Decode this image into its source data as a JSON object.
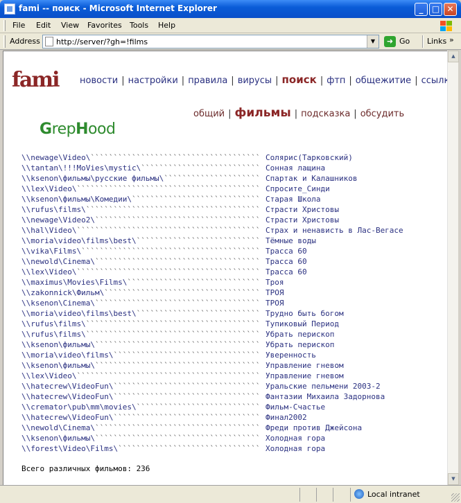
{
  "window": {
    "title": "fami -- поиск - Microsoft Internet Explorer",
    "min_glyph": "_",
    "max_glyph": "□",
    "close_glyph": "✕"
  },
  "menu": {
    "items": [
      "File",
      "Edit",
      "View",
      "Favorites",
      "Tools",
      "Help"
    ]
  },
  "address": {
    "label": "Address",
    "url": "http://server/?gh=!films",
    "go_label": "Go",
    "links_label": "Links",
    "more": "»"
  },
  "page": {
    "logo": "fami",
    "nav": [
      "новости",
      "настройки",
      "правила",
      "вирусы",
      "поиск",
      "фтп",
      "общежитие",
      "ссылки"
    ],
    "nav_active": "поиск",
    "subnav": [
      "общий",
      "фильмы",
      "подсказка",
      "обсудить"
    ],
    "subnav_active": "фильмы",
    "grephood": {
      "g": "G",
      "rep": "rep",
      "h": "H",
      "ood": "ood"
    },
    "results": [
      {
        "path": "\\\\newage\\Video\\",
        "film": "Солярис(Тарковский)"
      },
      {
        "path": "\\\\tantan\\!!!MoVies\\mystic\\",
        "film": "Сонная лащина"
      },
      {
        "path": "\\\\ksenon\\фильмы\\русские фильмы\\",
        "film": "Спартак и Калашников"
      },
      {
        "path": "\\\\lex\\Video\\",
        "film": "Спросите_Синди"
      },
      {
        "path": "\\\\ksenon\\фильмы\\Комедии\\",
        "film": "Старая Школа"
      },
      {
        "path": "\\\\rufus\\films\\",
        "film": "Страсти Христовы"
      },
      {
        "path": "\\\\newage\\Video2\\",
        "film": "Страсти Христовы"
      },
      {
        "path": "\\\\hal\\Video\\",
        "film": "Страх и ненависть в Лас-Вегасе"
      },
      {
        "path": "\\\\moria\\video\\films\\best\\",
        "film": "Тёмные воды"
      },
      {
        "path": "\\\\vika\\Films\\",
        "film": "Трасса 60"
      },
      {
        "path": "\\\\newold\\Cinema\\",
        "film": "Трасса 60"
      },
      {
        "path": "\\\\lex\\Video\\",
        "film": "Трасса 60"
      },
      {
        "path": "\\\\maximus\\Movies\\Films\\",
        "film": "Троя"
      },
      {
        "path": "\\\\zakonnick\\Фильм\\",
        "film": "ТРОЯ"
      },
      {
        "path": "\\\\ksenon\\Cinema\\",
        "film": "ТРОЯ"
      },
      {
        "path": "\\\\moria\\video\\films\\best\\",
        "film": "Трудно быть богом"
      },
      {
        "path": "\\\\rufus\\films\\",
        "film": "Тупиковый Период"
      },
      {
        "path": "\\\\rufus\\films\\",
        "film": "Убрать перископ"
      },
      {
        "path": "\\\\ksenon\\фильмы\\",
        "film": "Убрать перископ"
      },
      {
        "path": "\\\\moria\\video\\films\\",
        "film": "Уверенность"
      },
      {
        "path": "\\\\ksenon\\фильмы\\",
        "film": "Управление гневом"
      },
      {
        "path": "\\\\lex\\Video\\",
        "film": "Управление гневом"
      },
      {
        "path": "\\\\hatecrew\\VideoFun\\",
        "film": "Уральские пельмени 2003-2"
      },
      {
        "path": "\\\\hatecrew\\VideoFun\\",
        "film": "Фантазии Михаила Задорнова"
      },
      {
        "path": "\\\\cremator\\pub\\mm\\movies\\",
        "film": "Фильм-Счастье"
      },
      {
        "path": "\\\\hatecrew\\VideoFun\\",
        "film": "Финал2002"
      },
      {
        "path": "\\\\newold\\Cinema\\",
        "film": "Фреди против Джейсона"
      },
      {
        "path": "\\\\ksenon\\фильмы\\",
        "film": "Холодная гора"
      },
      {
        "path": "\\\\forest\\Video\\Films\\",
        "film": "Холодная гора"
      }
    ],
    "total": "Всего различных фильмов: 236"
  },
  "status": {
    "zone": "Local intranet"
  }
}
